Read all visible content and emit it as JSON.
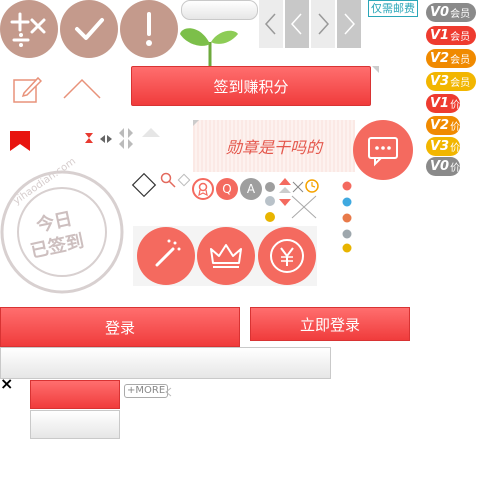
{
  "colors": {
    "tan": "#c49a8c",
    "red": "#f0443f",
    "coral": "#f46a5f",
    "grey": "#bdbdbd",
    "orange": "#f5a300",
    "gold": "#e8c000"
  },
  "shipping_note": "仅需邮费",
  "vip_badges": [
    {
      "level": "V0",
      "suffix": "会员",
      "color": "#8a8a8a"
    },
    {
      "level": "V1",
      "suffix": "会员",
      "color": "#ee3b2f"
    },
    {
      "level": "V2",
      "suffix": "会员",
      "color": "#f08a00"
    },
    {
      "level": "V3",
      "suffix": "会员",
      "color": "#f2b600"
    }
  ],
  "price_badges": [
    {
      "level": "V1",
      "suffix": "价",
      "color": "#ee3b2f"
    },
    {
      "level": "V2",
      "suffix": "价",
      "color": "#f08a00"
    },
    {
      "level": "V3",
      "suffix": "价",
      "color": "#f2b600"
    },
    {
      "level": "V0",
      "suffix": "价",
      "color": "#8a8a8a"
    }
  ],
  "checkin_button": "签到赚积分",
  "badge_question": "勋章是干吗的",
  "stamp": {
    "line1": "今日",
    "line2": "已签到",
    "site": "yihaodian.com"
  },
  "bottom_icons": [
    "magic-wand-icon",
    "crown-icon",
    "yuan-icon"
  ],
  "login_button": "登录",
  "login_now_button": "立即登录",
  "more_link": "+MORE",
  "close_glyph": "×",
  "small_tabs": [
    "Q",
    "A"
  ]
}
